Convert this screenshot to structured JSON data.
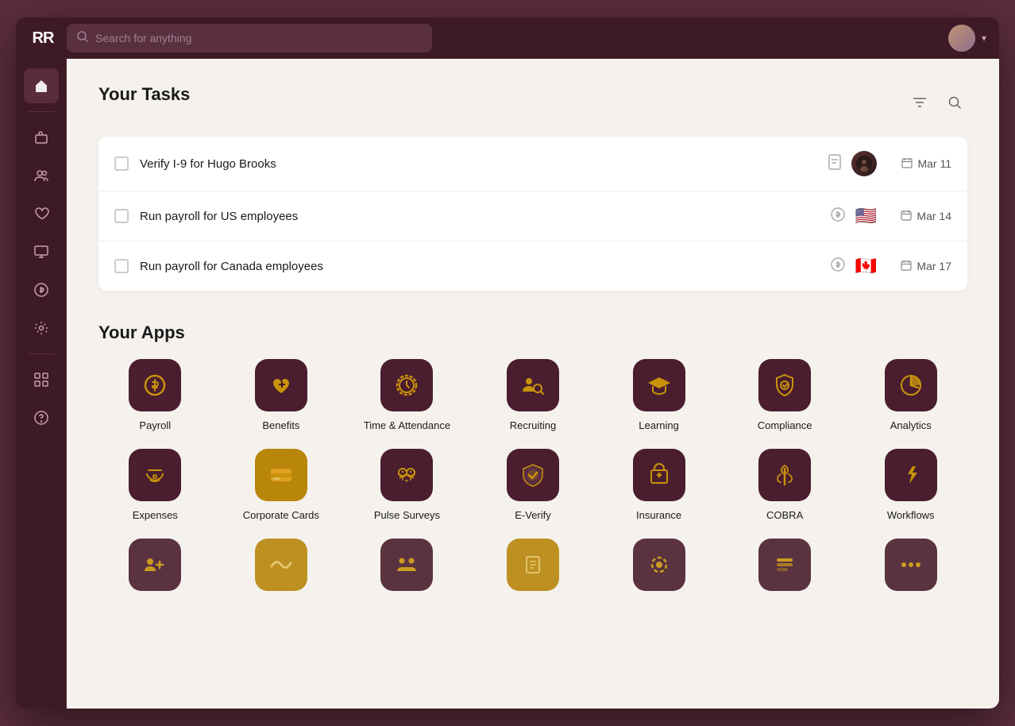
{
  "topbar": {
    "logo": "RR",
    "search_placeholder": "Search for anything",
    "search_value": ""
  },
  "sidebar": {
    "items": [
      {
        "id": "home",
        "icon": "🏠",
        "active": true
      },
      {
        "id": "briefcase",
        "icon": "💼",
        "active": false
      },
      {
        "id": "people",
        "icon": "👥",
        "active": false
      },
      {
        "id": "heart",
        "icon": "♡",
        "active": false
      },
      {
        "id": "monitor",
        "icon": "🖥",
        "active": false
      },
      {
        "id": "dollar",
        "icon": "💲",
        "active": false
      },
      {
        "id": "settings",
        "icon": "⚙",
        "active": false
      },
      {
        "id": "apps",
        "icon": "⊞",
        "active": false
      },
      {
        "id": "help",
        "icon": "?",
        "active": false
      }
    ]
  },
  "tasks": {
    "title": "Your Tasks",
    "items": [
      {
        "label": "Verify I-9 for Hugo Brooks",
        "has_doc": true,
        "has_avatar": true,
        "flag": null,
        "date": "Mar 11"
      },
      {
        "label": "Run payroll for US employees",
        "has_doc": false,
        "has_avatar": false,
        "flag": "🇺🇸",
        "date": "Mar 14"
      },
      {
        "label": "Run payroll for Canada employees",
        "has_doc": false,
        "has_avatar": false,
        "flag": "🇨🇦",
        "date": "Mar 17"
      }
    ]
  },
  "apps": {
    "title": "Your Apps",
    "items": [
      {
        "id": "payroll",
        "label": "Payroll",
        "icon_type": "dollar-circle"
      },
      {
        "id": "benefits",
        "label": "Benefits",
        "icon_type": "heart-plus"
      },
      {
        "id": "time",
        "label": "Time & Attendance",
        "icon_type": "clock"
      },
      {
        "id": "recruiting",
        "label": "Recruiting",
        "icon_type": "people-search"
      },
      {
        "id": "learning",
        "label": "Learning",
        "icon_type": "graduation"
      },
      {
        "id": "compliance",
        "label": "Compliance",
        "icon_type": "shield-check"
      },
      {
        "id": "analytics",
        "label": "Analytics",
        "icon_type": "pie-chart"
      },
      {
        "id": "expenses",
        "label": "Expenses",
        "icon_type": "hand-dollar"
      },
      {
        "id": "corporate-cards",
        "label": "Corporate Cards",
        "icon_type": "credit-card"
      },
      {
        "id": "pulse-surveys",
        "label": "Pulse Surveys",
        "icon_type": "face-check"
      },
      {
        "id": "e-verify",
        "label": "E-Verify",
        "icon_type": "badge-check"
      },
      {
        "id": "insurance",
        "label": "Insurance",
        "icon_type": "briefcase-plus"
      },
      {
        "id": "cobra",
        "label": "COBRA",
        "icon_type": "caduceus"
      },
      {
        "id": "workflows",
        "label": "Workflows",
        "icon_type": "lightning"
      },
      {
        "id": "app15",
        "label": "",
        "icon_type": "people-plus"
      },
      {
        "id": "app16",
        "label": "",
        "icon_type": "wave"
      },
      {
        "id": "app17",
        "label": "",
        "icon_type": "people2"
      },
      {
        "id": "app18",
        "label": "",
        "icon_type": "bookmark"
      },
      {
        "id": "app19",
        "label": "",
        "icon_type": "circle-o"
      },
      {
        "id": "app20",
        "label": "",
        "icon_type": "minus-square"
      },
      {
        "id": "app21",
        "label": "",
        "icon_type": "dots"
      }
    ]
  },
  "colors": {
    "accent": "#c8930a",
    "dark_bg": "#4a1e2e",
    "icon_gold": "#c8930a"
  }
}
